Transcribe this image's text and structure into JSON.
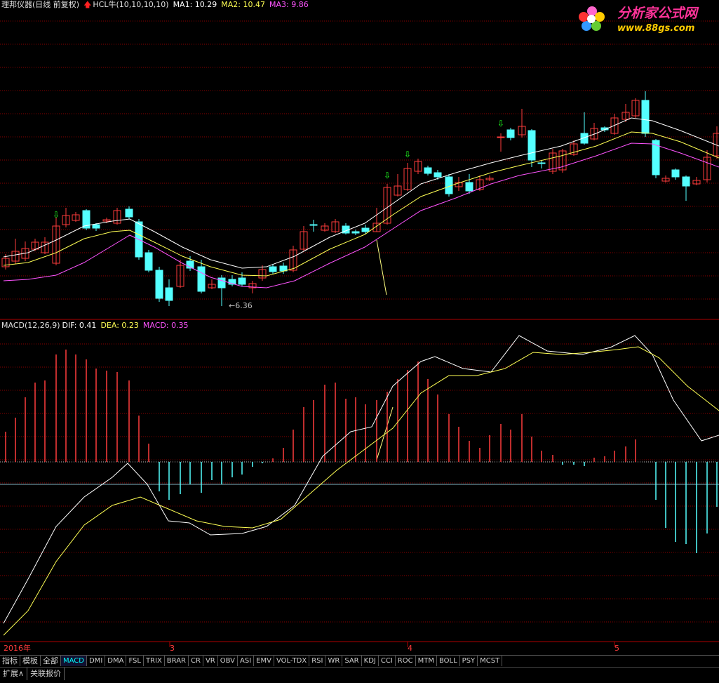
{
  "header": {
    "stock_name": "理邦仪器(日线 前复权)",
    "indicator_label": "HCL牛(10,10,10,10)",
    "ma1": "MA1: 10.29",
    "ma2": "MA2: 10.47",
    "ma3": "MA3: 9.86"
  },
  "macd_header": {
    "name": "MACD(12,26,9)",
    "dif": "DIF: 0.41",
    "dea": "DEA: 0.23",
    "macd": "MACD: 0.35"
  },
  "low_annotation": "6.36",
  "logo": {
    "title": "分析家公式网",
    "url": "www.88gs.com"
  },
  "date_axis": [
    "2016年",
    "3",
    "4",
    "5"
  ],
  "tabs": [
    {
      "label": "指标",
      "cn": true
    },
    {
      "label": "模板",
      "cn": true
    },
    {
      "label": "全部",
      "cn": true
    },
    {
      "label": "MACD",
      "active": true
    },
    {
      "label": "DMI"
    },
    {
      "label": "DMA"
    },
    {
      "label": "FSL"
    },
    {
      "label": "TRIX"
    },
    {
      "label": "BRAR"
    },
    {
      "label": "CR"
    },
    {
      "label": "VR"
    },
    {
      "label": "OBV"
    },
    {
      "label": "ASI"
    },
    {
      "label": "EMV"
    },
    {
      "label": "VOL-TDX"
    },
    {
      "label": "RSI"
    },
    {
      "label": "WR"
    },
    {
      "label": "SAR"
    },
    {
      "label": "KDJ"
    },
    {
      "label": "CCI"
    },
    {
      "label": "ROC"
    },
    {
      "label": "MTM"
    },
    {
      "label": "BOLL"
    },
    {
      "label": "PSY"
    },
    {
      "label": "MCST"
    }
  ],
  "bottom_tabs": [
    "扩展∧",
    "关联报价"
  ],
  "colors": {
    "up": "#ff3c3c",
    "down": "#54ffff",
    "ma1": "#ffffff",
    "ma2": "#ffff54",
    "ma3": "#ff54ff",
    "dif": "#ffffff",
    "dea": "#ffff54",
    "grid": "#8b0000"
  }
}
